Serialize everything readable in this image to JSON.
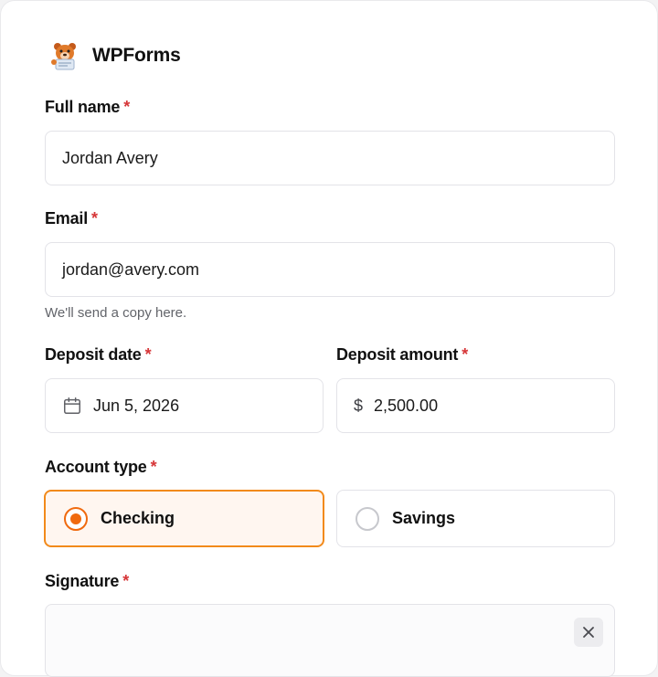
{
  "brand": {
    "name": "WPForms",
    "logo_icon": "wpforms-bear-logo-icon"
  },
  "fields": {
    "full_name": {
      "label": "Full name",
      "required_mark": "*",
      "value": "Jordan Avery"
    },
    "email": {
      "label": "Email",
      "required_mark": "*",
      "value": "jordan@avery.com",
      "hint": "We'll send a copy here."
    },
    "deposit_date": {
      "label": "Deposit date",
      "required_mark": "*",
      "value": "Jun 5, 2026",
      "icon": "calendar-icon"
    },
    "deposit_amount": {
      "label": "Deposit amount",
      "required_mark": "*",
      "prefix": "$",
      "value": "2,500.00"
    },
    "account_type": {
      "label": "Account type",
      "required_mark": "*",
      "options": [
        {
          "label": "Checking",
          "selected": true
        },
        {
          "label": "Savings",
          "selected": false
        }
      ]
    },
    "signature": {
      "label": "Signature",
      "required_mark": "*",
      "clear_icon": "close-icon"
    }
  },
  "colors": {
    "accent": "#f06a0f",
    "required": "#d63638",
    "selected_bg": "#fff6f0"
  }
}
